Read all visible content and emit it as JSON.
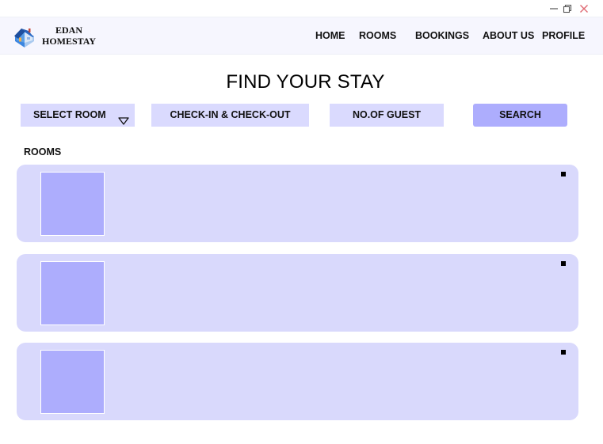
{
  "window": {
    "controls": [
      "minimize-icon",
      "maximize-icon",
      "close-icon"
    ],
    "close_color": "#e06c75"
  },
  "header": {
    "brand_line1": "EDAN",
    "brand_line2": "HOMESTAY",
    "logo_icon": "house-icon",
    "nav": {
      "home": "HOME",
      "rooms": "ROOMS",
      "bookings": "BOOKINGS",
      "about": "ABOUT US",
      "profile": "PROFILE"
    }
  },
  "main": {
    "title": "FIND YOUR STAY",
    "search": {
      "room_select": "SELECT ROOM",
      "room_select_icon": "chevron-down-icon",
      "checkin_checkout": "CHECK-IN & CHECK-OUT",
      "guests": "NO.OF GUEST",
      "search_button": "SEARCH"
    },
    "rooms_label": "ROOMS",
    "rooms_count": 3
  },
  "colors": {
    "header_bg": "#f6f6fe",
    "field_bg": "#dadafe",
    "accent": "#adadfd",
    "card_bg": "#d9d9fc"
  }
}
